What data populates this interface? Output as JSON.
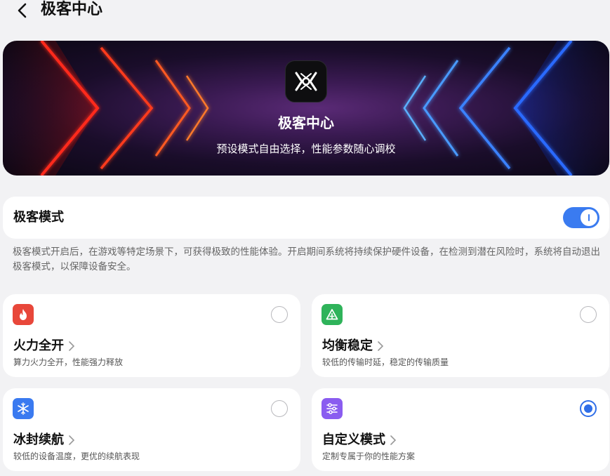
{
  "header": {
    "title": "极客中心"
  },
  "banner": {
    "title": "极客中心",
    "subtitle": "预设模式自由选择，性能参数随心调校"
  },
  "geek_mode": {
    "label": "极客模式",
    "enabled": true,
    "description": "极客模式开启后，在游戏等特定场景下，可获得极致的性能体验。开启期间系统将持续保护硬件设备，在检测到潜在风险时，系统将自动退出极客模式，以保障设备安全。"
  },
  "options": [
    {
      "title": "火力全开",
      "description": "算力火力全开，性能强力释放",
      "icon": "flame-icon",
      "color": "#e8473a",
      "selected": false
    },
    {
      "title": "均衡稳定",
      "description": "较低的传输时延，稳定的传输质量",
      "icon": "triangle-icon",
      "color": "#2fb35a",
      "selected": false
    },
    {
      "title": "冰封续航",
      "description": "较低的设备温度，更优的续航表现",
      "icon": "snowflake-icon",
      "color": "#3a7af0",
      "selected": false
    },
    {
      "title": "自定义模式",
      "description": "定制专属于你的性能方案",
      "icon": "sliders-icon",
      "color": "#8a5cf0",
      "selected": true
    }
  ],
  "colors": {
    "accent": "#3a7bf0",
    "background": "#f2f2f4"
  }
}
